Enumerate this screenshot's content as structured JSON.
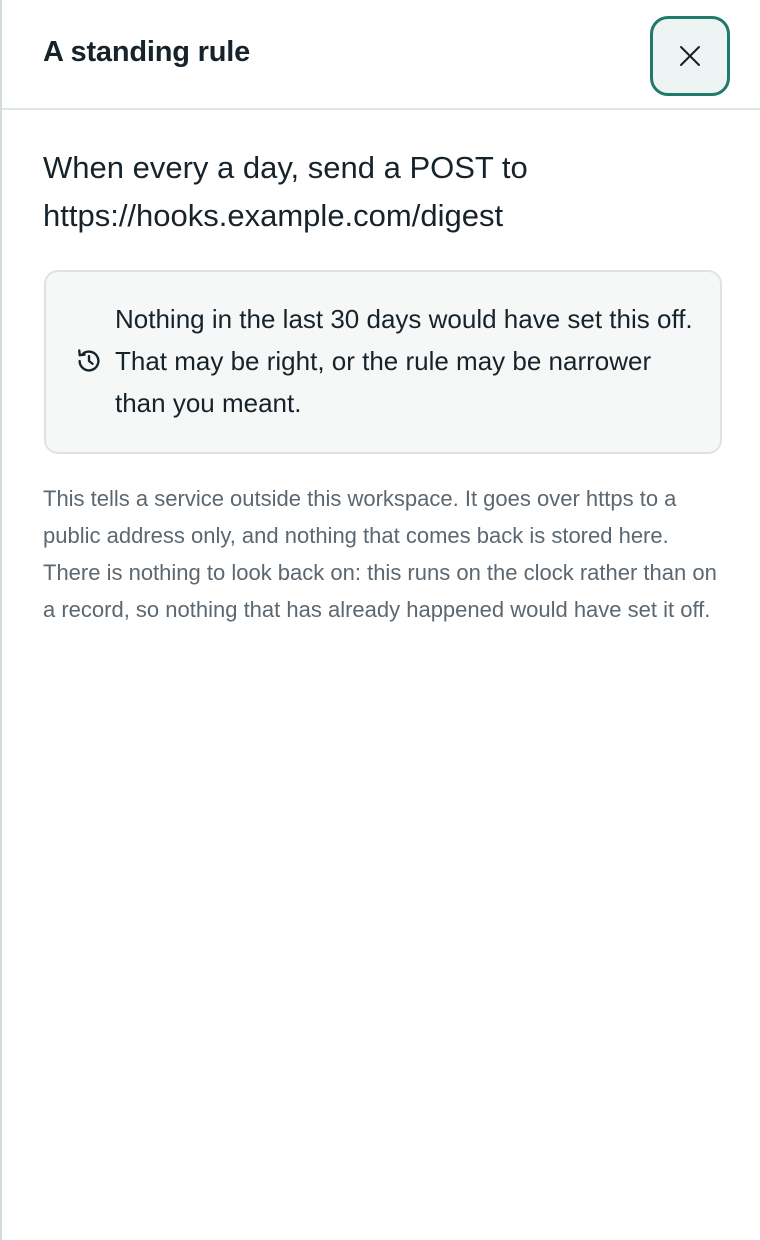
{
  "panel": {
    "title": "A standing rule",
    "close_icon": "close-icon"
  },
  "rule": {
    "summary": "When every a day, send a POST to https://hooks.example.com/digest"
  },
  "notice": {
    "icon": "history-icon",
    "text": "Nothing in the last 30 days would have set this off. That may be right, or the rule may be narrower than you meant."
  },
  "explanation": {
    "paragraph_1": "This tells a service outside this workspace. It goes over https to a public address only, and nothing that comes back is stored here.",
    "paragraph_2": "There is nothing to look back on: this runs on the clock rather than on a record, so nothing that has already happened would have set it off."
  },
  "colors": {
    "accent": "#1f7a6a",
    "text": "#17232b",
    "muted_text": "#5c6770",
    "notice_bg": "#f6f8f8",
    "border": "#dde3e3"
  }
}
